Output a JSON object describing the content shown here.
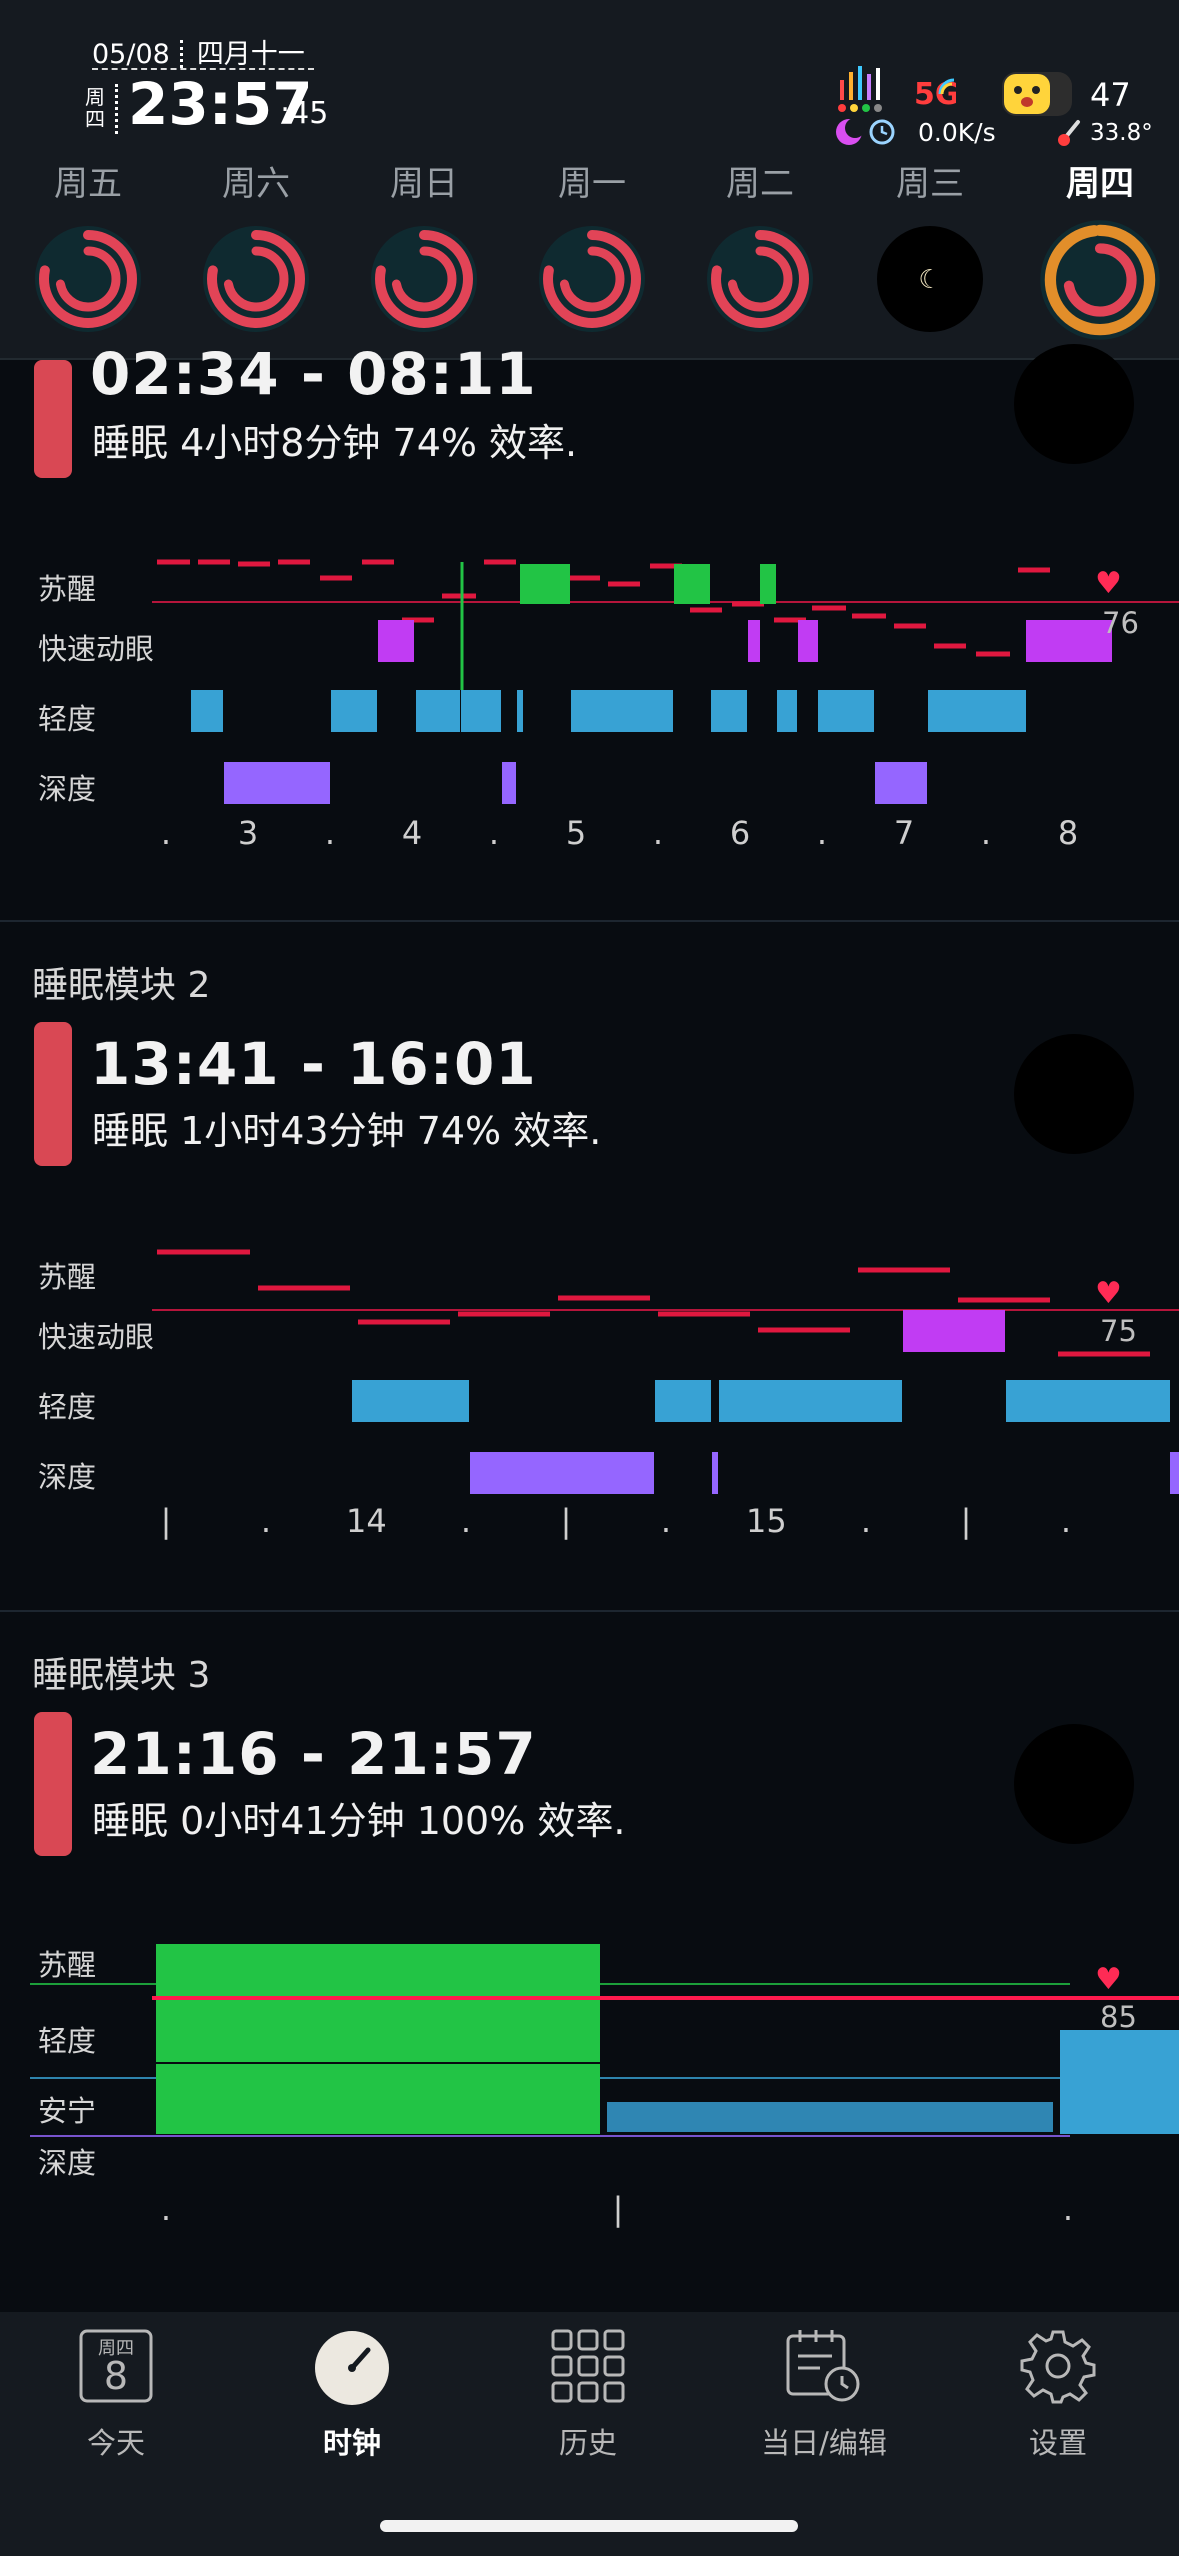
{
  "status": {
    "date": "05/08",
    "lunar": "四月十一",
    "weekday": "周四",
    "time": "23:57",
    "seconds": ":45",
    "net_speed": "0.0K/s",
    "battery": "47",
    "temperature": "33.8°",
    "network": "5G"
  },
  "days": [
    {
      "label": "周五"
    },
    {
      "label": "周六"
    },
    {
      "label": "周日"
    },
    {
      "label": "周一"
    },
    {
      "label": "周二"
    },
    {
      "label": "周三"
    },
    {
      "label": "周四"
    }
  ],
  "blocks": [
    {
      "title": "",
      "range": "02:34 - 08:11",
      "summary": "睡眠 4小时8分钟 74% 效率.",
      "stages": [
        "苏醒",
        "快速动眼",
        "轻度",
        "深度"
      ],
      "heart_rate": "76",
      "x_ticks": [
        ".",
        "3",
        ".",
        "4",
        ".",
        "5",
        ".",
        "6",
        ".",
        "7",
        ".",
        "8"
      ]
    },
    {
      "title": "睡眠模块 2",
      "range": "13:41 - 16:01",
      "summary": "睡眠 1小时43分钟 74% 效率.",
      "stages": [
        "苏醒",
        "快速动眼",
        "轻度",
        "深度"
      ],
      "heart_rate": "75",
      "x_ticks": [
        "|",
        ".",
        "14",
        ".",
        "|",
        ".",
        "15",
        ".",
        "|",
        "."
      ]
    },
    {
      "title": "睡眠模块 3",
      "range": "21:16 - 21:57",
      "summary": "睡眠 0小时41分钟 100% 效率.",
      "stages": [
        "苏醒",
        "轻度",
        "安宁",
        "深度"
      ],
      "heart_rate": "85",
      "x_ticks": [
        ".",
        "|",
        "."
      ]
    }
  ],
  "nav": [
    {
      "label": "今天",
      "icon": "calendar-day-icon",
      "badge_top": "周四",
      "badge_num": "8"
    },
    {
      "label": "时钟",
      "icon": "clock-icon"
    },
    {
      "label": "历史",
      "icon": "grid-icon"
    },
    {
      "label": "当日/编辑",
      "icon": "calendar-edit-icon"
    },
    {
      "label": "设置",
      "icon": "gear-icon"
    }
  ],
  "colors": {
    "awake": "#22c445",
    "rem": "#c13cf3",
    "light": "#38a2d4",
    "deep": "#9566ff",
    "hr_line": "#ff1a4d",
    "ring": "#e24457",
    "ring_today": "#e28e2a"
  }
}
